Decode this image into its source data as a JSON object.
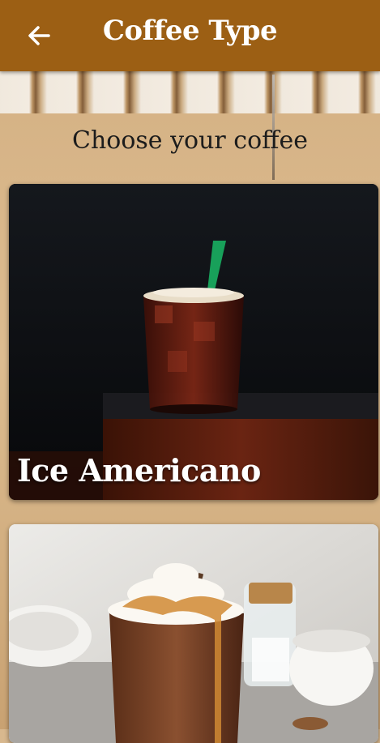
{
  "header": {
    "title": "Coffee Type",
    "back_icon": "arrow-left-icon"
  },
  "subtitle": "Choose your coffee",
  "coffees": [
    {
      "name": "Ice Americano",
      "image": "iced-americano-photo"
    },
    {
      "name": "",
      "image": "caramel-latte-photo"
    }
  ],
  "colors": {
    "appbar": "#9c5f14",
    "background": "#d8b88e"
  }
}
